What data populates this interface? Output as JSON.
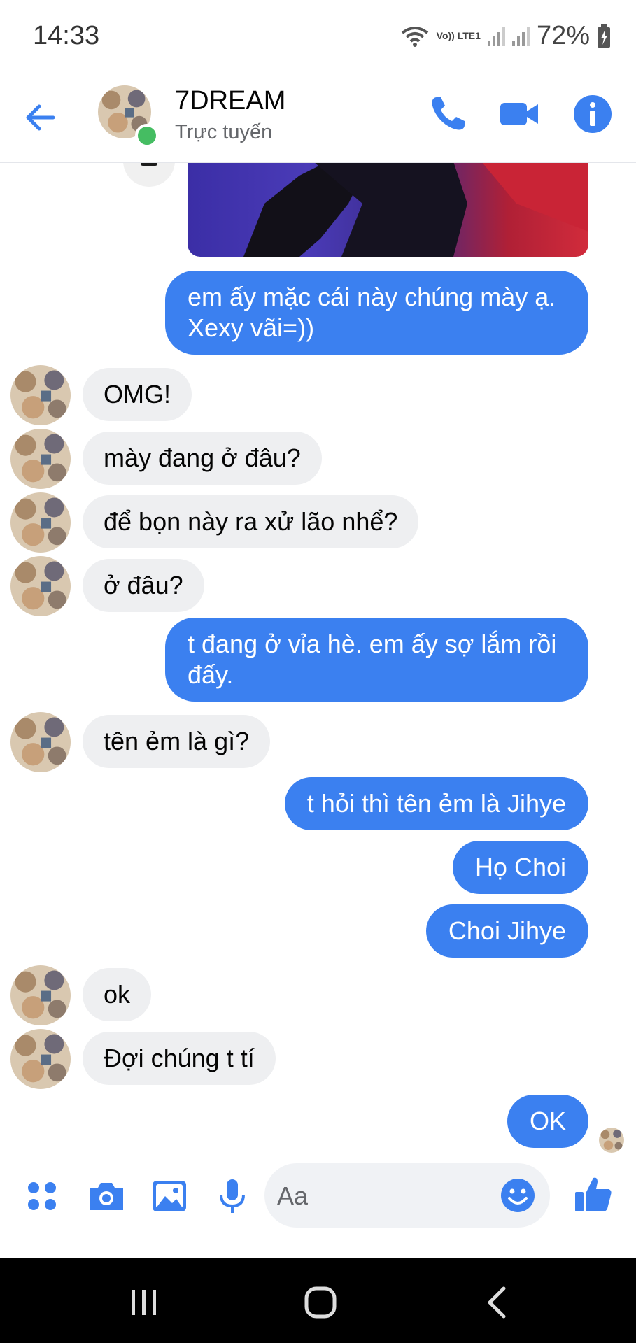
{
  "status_bar": {
    "time": "14:33",
    "lte_label": "Vo)) LTE1",
    "battery": "72%"
  },
  "header": {
    "title": "7DREAM",
    "subtitle": "Trực tuyến"
  },
  "messages": [
    {
      "from": "me",
      "text": "em ấy mặc cái này chúng mày ạ. Xexy vãi=))"
    },
    {
      "from": "them",
      "text": "OMG!"
    },
    {
      "from": "them",
      "text": "mày đang ở đâu?"
    },
    {
      "from": "them",
      "text": "để bọn này ra xử lão nhể?"
    },
    {
      "from": "them",
      "text": "ở đâu?"
    },
    {
      "from": "me",
      "text": "t đang ở vỉa hè. em ấy sợ lắm rồi đấy."
    },
    {
      "from": "them",
      "text": "tên ẻm là gì?"
    },
    {
      "from": "me",
      "text": "t hỏi thì tên ẻm là Jihye"
    },
    {
      "from": "me",
      "text": "Họ Choi"
    },
    {
      "from": "me",
      "text": "Choi Jihye"
    },
    {
      "from": "them",
      "text": "ok"
    },
    {
      "from": "them",
      "text": "Đợi chúng t tí"
    },
    {
      "from": "me",
      "text": "OK"
    }
  ],
  "composer": {
    "placeholder": "Aa"
  },
  "colors": {
    "accent": "#3b80f0",
    "incoming_bubble": "#eeeff1",
    "online": "#45bd62"
  }
}
